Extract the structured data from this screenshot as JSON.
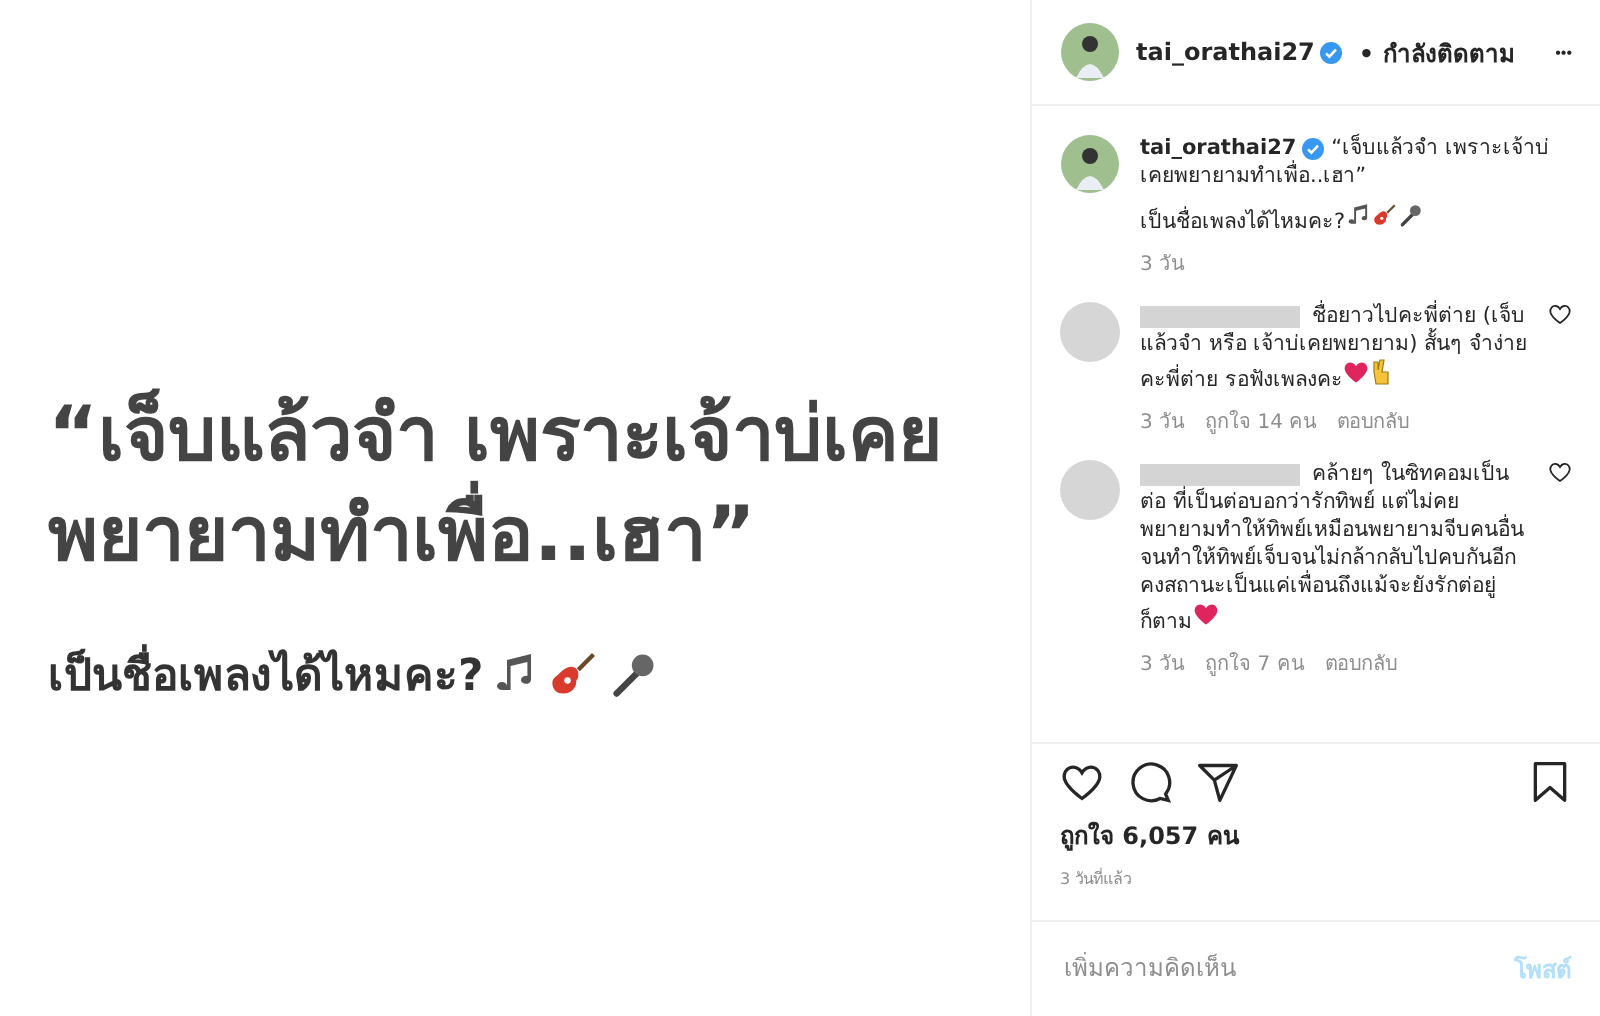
{
  "post_image": {
    "quote": "“เจ็บแล้วจำ เพราะเจ้าบ่เคย พยายามทำเพื่อ..เฮา”",
    "question": "เป็นชื่อเพลงได้ไหมคะ?"
  },
  "header": {
    "username": "tai_orathai27",
    "verified": true,
    "follow_status": "• กำลังติดตาม",
    "more": "•••"
  },
  "caption": {
    "username": "tai_orathai27",
    "verified": true,
    "text": "“เจ็บแล้วจำ เพราะเจ้าบ่เคยพยายามทำเพื่อ..เฮา”",
    "question": "เป็นชื่อเพลงได้ไหมคะ?",
    "time": "3 วัน"
  },
  "comments": [
    {
      "text": "ชื่อยาวไปคะพี่ต่าย (เจ็บแล้วจำ หรือ เจ้าบ่เคยพยายาม) สั้นๆ จำง่ายคะพี่ต่าย รอฟังเพลงคะ",
      "time": "3 วัน",
      "likes": "ถูกใจ 14 คน",
      "reply": "ตอบกลับ",
      "liked": false
    },
    {
      "text": "คล้ายๆ ในซิทคอมเป็นต่อ ที่เป็นต่อบอกว่ารักทิพย์ แต่ไม่คยพยายามทำให้ทิพย์เหมือนพยายามจีบคนอื่น จนทำให้ทิพย์เจ็บจนไม่กล้ากลับไปคบกันอีกคงสถานะเป็นแค่เพื่อนถึงแม้จะยังรักต่อยู่ก็ตาม",
      "time": "3 วัน",
      "likes": "ถูกใจ 7 คน",
      "reply": "ตอบกลับ",
      "liked": false
    }
  ],
  "likes": "ถูกใจ 6,057 คน",
  "posted": "3 วันที่แล้ว",
  "comment_box": {
    "placeholder": "เพิ่มความคิดเห็น",
    "post_button": "โพสต์",
    "disabled": true
  }
}
